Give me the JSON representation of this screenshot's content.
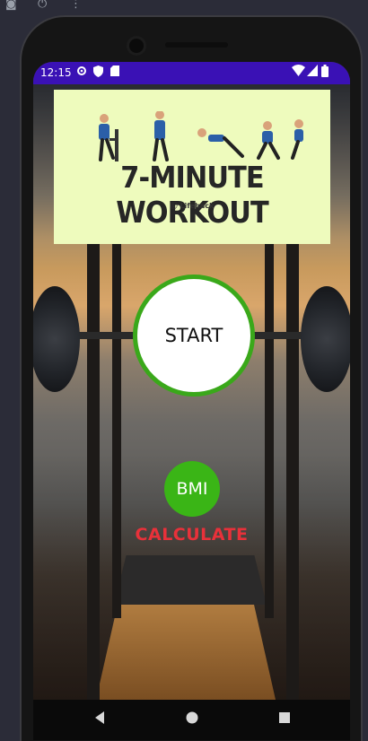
{
  "emulator": {
    "icons": [
      "camera-icon",
      "rotate-icon",
      "more-icon"
    ]
  },
  "status_bar": {
    "time": "12:15",
    "left_icons": [
      "gear-icon",
      "shield-icon",
      "sd-card-icon"
    ],
    "right_icons": [
      "wifi-icon",
      "signal-icon",
      "battery-icon"
    ],
    "color": "#3a11b5"
  },
  "banner": {
    "title": "7-MINUTE WORKOUT",
    "brand": "Lifehack",
    "background": "#eefbbd"
  },
  "start_button": {
    "label": "START",
    "ring_color": "#3aa81a"
  },
  "bmi_button": {
    "label": "BMI",
    "color": "#3ab516"
  },
  "calculate_label": {
    "text": "CALCULATE",
    "color": "#e8313a"
  },
  "nav_bar": {
    "items": [
      "back-icon",
      "home-icon",
      "overview-icon"
    ]
  }
}
